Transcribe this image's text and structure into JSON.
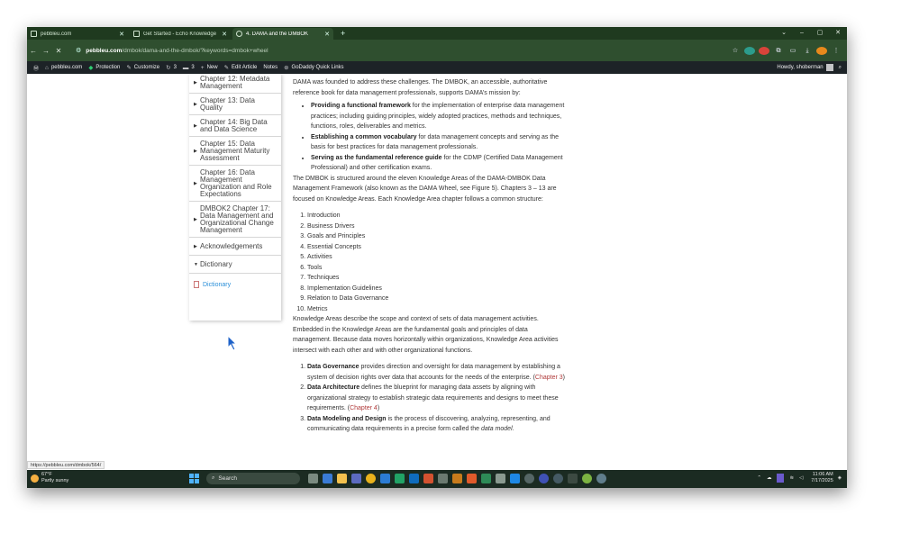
{
  "browser": {
    "tabs": [
      {
        "title": "pebbleu.com",
        "active": false
      },
      {
        "title": "Get Started - Echo Knowledge",
        "active": false
      },
      {
        "title": "4. DAMA and the DMBOK",
        "active": true
      }
    ],
    "new_tab": "+",
    "window_controls": [
      "⌄",
      "–",
      "▢",
      "✕"
    ],
    "url_host": "pebbleu.com",
    "url_path": "/dmbok/dama-and-the-dmbok/?keywords=dmbok+wheel"
  },
  "wpbar": {
    "site": "pebbleu.com",
    "items": [
      {
        "icon": "shield-icon",
        "label": "Protection"
      },
      {
        "icon": "brush-icon",
        "label": "Customize"
      },
      {
        "icon": "refresh-icon",
        "label": "3"
      },
      {
        "icon": "comment-icon",
        "label": "3"
      },
      {
        "icon": "plus-icon",
        "label": "New"
      },
      {
        "icon": "pencil-icon",
        "label": "Edit Article"
      },
      {
        "icon": "",
        "label": "Notes"
      },
      {
        "icon": "godaddy-icon",
        "label": "GoDaddy Quick Links"
      }
    ],
    "howdy": "Howdy, shoberman"
  },
  "sidebar": {
    "items": [
      {
        "label": "Chapter 12: Metadata Management",
        "expanded": false
      },
      {
        "label": "Chapter 13: Data Quality",
        "expanded": false
      },
      {
        "label": "Chapter 14: Big Data and Data Science",
        "expanded": false
      },
      {
        "label": "Chapter 15: Data Management Maturity Assessment",
        "expanded": false
      },
      {
        "label": "Chapter 16: Data Management Organization and Role Expectations",
        "expanded": false
      },
      {
        "label": "DMBOK2 Chapter 17: Data Management and Organizational Change Management",
        "expanded": false
      },
      {
        "label": "Acknowledgements",
        "expanded": false
      },
      {
        "label": "Dictionary",
        "expanded": true
      }
    ],
    "sub_item": "Dictionary"
  },
  "article": {
    "intro": "DAMA was founded to address these challenges. The DMBOK, an accessible, authoritative reference book for data management professionals, supports DAMA’s mission by:",
    "bullets": [
      {
        "bold": "Providing a functional framework",
        "text": " for the implementation of enterprise data management practices; including guiding principles, widely adopted practices, methods and techniques, functions, roles, deliverables and metrics."
      },
      {
        "bold": "Establishing a common vocabulary",
        "text": " for data management concepts and serving as the basis for best practices for data management professionals."
      },
      {
        "bold": "Serving as the fundamental reference guide",
        "text": " for the CDMP (Certified Data Management Professional) and other certification exams."
      }
    ],
    "para2": "The DMBOK is structured around the eleven Knowledge Areas of the DAMA-DMBOK Data Management Framework (also known as the DAMA Wheel, see Figure 5). Chapters 3 – 13 are focused on Knowledge Areas. Each Knowledge Area chapter follows a common structure:",
    "structure": [
      "Introduction",
      "Business Drivers",
      "Goals and Principles",
      "Essential Concepts",
      "Activities",
      "Tools",
      "Techniques",
      "Implementation Guidelines",
      "Relation to Data Governance",
      "Metrics"
    ],
    "para3": "Knowledge Areas describe the scope and context of sets of data management activities. Embedded in the Knowledge Areas are the fundamental goals and principles of data management. Because data moves horizontally within organizations, Knowledge Area activities intersect with each other and with other organizational functions.",
    "areas": [
      {
        "bold": "Data Governance",
        "text": " provides direction and oversight for data management by establishing a system of decision rights over data that accounts for the needs of the enterprise. (",
        "ref": "Chapter 3",
        "end": ")"
      },
      {
        "bold": "Data Architecture",
        "text": " defines the blueprint for managing data assets by aligning with organizational strategy to establish strategic data requirements and designs to meet these requirements. (",
        "ref": "Chapter 4",
        "end": ")"
      },
      {
        "bold": "Data Modeling and Design",
        "text": " is the process of discovering, analyzing, representing, and communicating data requirements in a precise form called the ",
        "ref": "data model.",
        "end": ""
      }
    ]
  },
  "status_url": "https://pebbleu.com/dmbok/564/",
  "taskbar": {
    "weather_temp": "67°F",
    "weather_desc": "Partly sunny",
    "search": "Search",
    "time": "11:06 AM",
    "date": "7/17/2025"
  },
  "colors": {
    "tab_strip": "#1f3a1f",
    "toolbar": "#2f4f2f",
    "wpbar": "#1d2327",
    "link": "#2a8fd9",
    "chapter_ref": "#b03a3a",
    "taskbar": "#1b2b22"
  }
}
